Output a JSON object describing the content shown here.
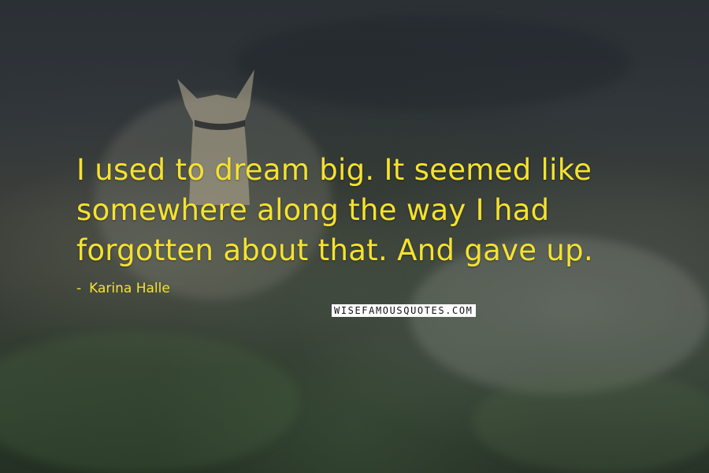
{
  "quote": {
    "lines": [
      "I used to dream big. It seemed like",
      "somewhere along the way I had",
      "forgotten about that. And gave up."
    ],
    "color": "#f5e22f"
  },
  "author": {
    "dash": "-",
    "name": "Karina Halle"
  },
  "watermark": {
    "text": "WISEFAMOUSQUOTES.COM"
  },
  "background": {
    "description_icon": "dog-in-ocean-waves-photo"
  }
}
